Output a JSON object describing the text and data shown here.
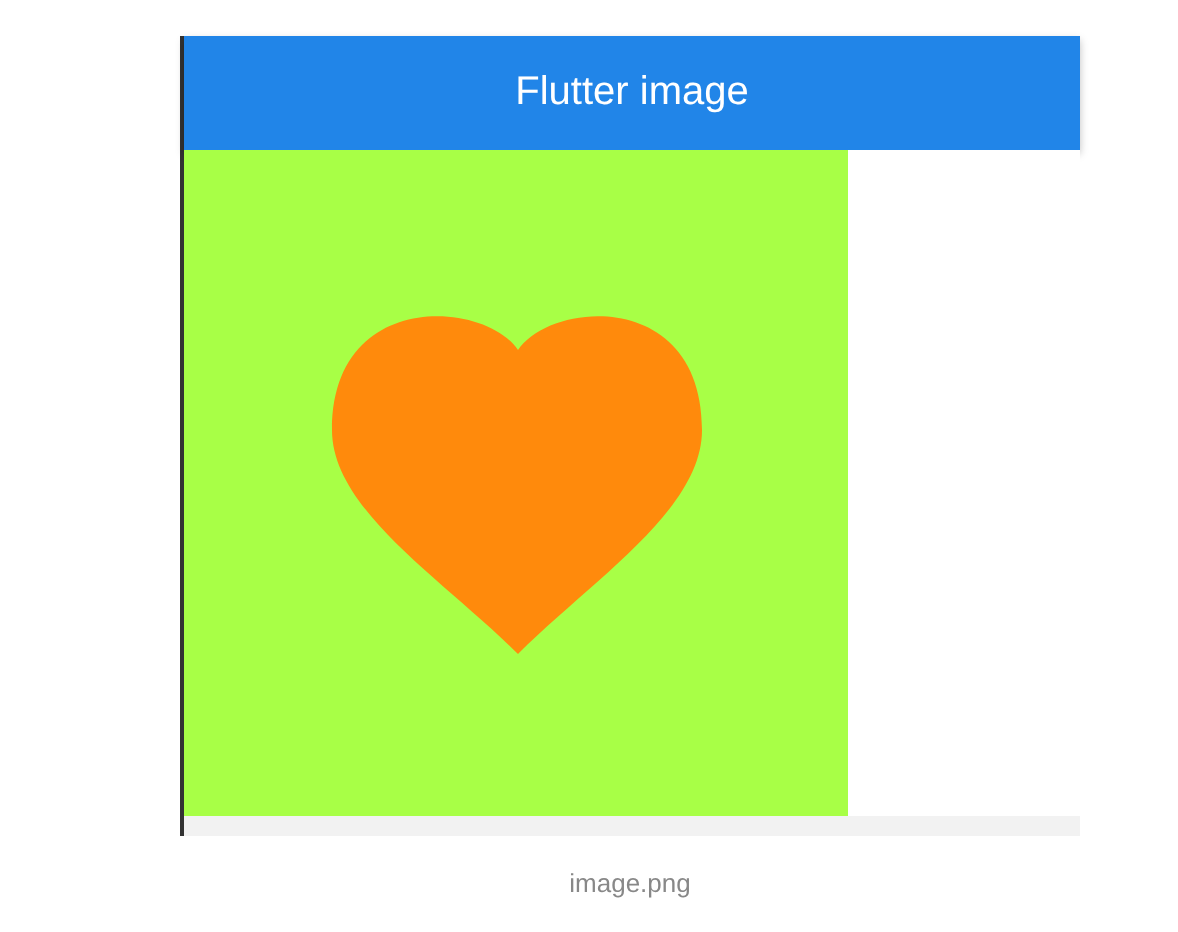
{
  "app_bar": {
    "title": "Flutter image"
  },
  "caption": "image.png"
}
